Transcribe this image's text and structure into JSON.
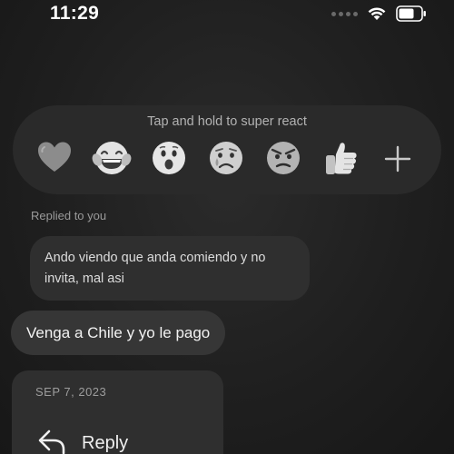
{
  "status_bar": {
    "time": "11:29"
  },
  "reactions": {
    "hint": "Tap and hold to super react",
    "items": [
      {
        "icon": "heart-icon",
        "color": "#8a8a8a"
      },
      {
        "icon": "laughing-crying-face-icon",
        "color": "#e2e2e2"
      },
      {
        "icon": "surprised-face-icon",
        "color": "#e2e2e2"
      },
      {
        "icon": "crying-face-icon",
        "color": "#c8c8c8"
      },
      {
        "icon": "angry-face-icon",
        "color": "#b5b5b5"
      },
      {
        "icon": "thumbs-up-icon",
        "color": "#e2e2e2"
      }
    ],
    "more_icon": "plus-icon"
  },
  "thread": {
    "replied_label": "Replied to you",
    "quoted_message": "Ando viendo que anda comiendo y no invita, mal asi",
    "message": "Venga a Chile y yo le pago"
  },
  "context_menu": {
    "date": "SEP 7, 2023",
    "reply_label": "Reply",
    "reply_icon": "reply-arrow-icon"
  }
}
